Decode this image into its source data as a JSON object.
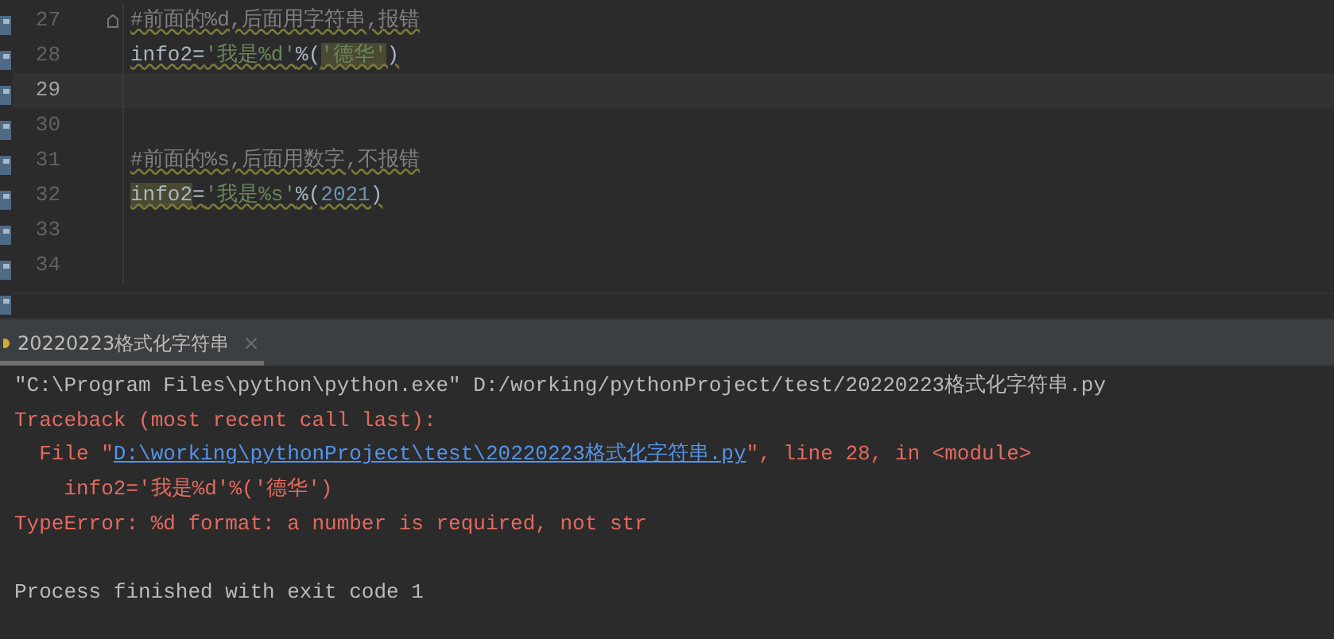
{
  "editor": {
    "lines": [
      {
        "number": "27",
        "selected": false,
        "fold": true,
        "tokens": [
          {
            "kind": "comment",
            "text": "#前面的%d,后面用字符串,报错"
          }
        ]
      },
      {
        "number": "28",
        "selected": false,
        "fold": false,
        "tokens": [
          {
            "kind": "plain",
            "text": "info2="
          },
          {
            "kind": "string",
            "text": "'我是%d'"
          },
          {
            "kind": "plain",
            "text": "%("
          },
          {
            "kind": "string",
            "text": "'德华'",
            "highlighted": true
          },
          {
            "kind": "plain",
            "text": ")"
          }
        ]
      },
      {
        "number": "29",
        "selected": true,
        "fold": false
      },
      {
        "number": "30",
        "selected": false,
        "fold": false
      },
      {
        "number": "31",
        "selected": false,
        "fold": false,
        "tokens": [
          {
            "kind": "comment",
            "text": "#前面的%s,后面用数字,不报错"
          }
        ]
      },
      {
        "number": "32",
        "selected": false,
        "fold": false,
        "tokens": [
          {
            "kind": "plain",
            "text": "info2",
            "highlighted": true
          },
          {
            "kind": "plain",
            "text": "="
          },
          {
            "kind": "string",
            "text": "'我是%s'"
          },
          {
            "kind": "plain",
            "text": "%("
          },
          {
            "kind": "number",
            "text": "2021"
          },
          {
            "kind": "plain",
            "text": ")"
          }
        ]
      },
      {
        "number": "33",
        "selected": false,
        "fold": false
      },
      {
        "number": "34",
        "selected": false,
        "fold": false
      }
    ]
  },
  "run_tabs": [
    {
      "label": "20220223格式化字符串",
      "selected": true
    }
  ],
  "console": {
    "lines": [
      {
        "kind": "command",
        "parts": [
          {
            "text": "\"C:\\Program Files\\python\\python.exe\" D:/working/pythonProject/test/20220223格式化字符串.py"
          }
        ]
      },
      {
        "kind": "error",
        "parts": [
          {
            "text": "Traceback (most recent call last):"
          }
        ]
      },
      {
        "kind": "error",
        "parts": [
          {
            "text": "  File \""
          },
          {
            "text": "D:\\working\\pythonProject\\test\\20220223格式化字符串.py",
            "link": true
          },
          {
            "text": "\", line 28, in <module>"
          }
        ]
      },
      {
        "kind": "error",
        "parts": [
          {
            "text": "    info2='我是%d'%('德华')"
          }
        ]
      },
      {
        "kind": "error",
        "parts": [
          {
            "text": "TypeError: %d format: a number is required, not str"
          }
        ]
      },
      {
        "kind": "exit",
        "parts": [
          {
            "text": "Process finished with exit code 1"
          }
        ]
      }
    ]
  }
}
